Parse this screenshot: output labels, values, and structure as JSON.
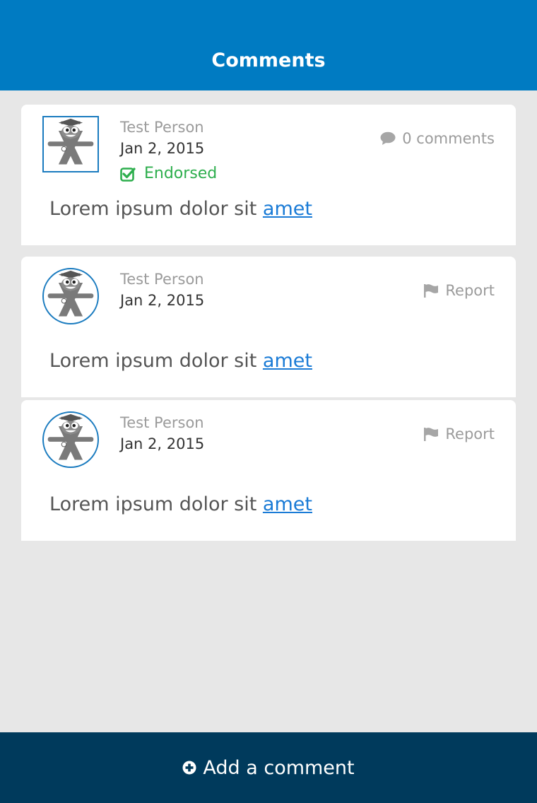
{
  "header": {
    "title": "Comments"
  },
  "comments": [
    {
      "author": "Test Person",
      "date": "Jan 2, 2015",
      "endorsed_label": "Endorsed",
      "meta_label": "0 comments",
      "meta_icon": "speech-bubble-icon",
      "body_text": "Lorem ipsum dolor sit ",
      "body_link": "amet",
      "avatar_shape": "square"
    },
    {
      "author": "Test Person",
      "date": "Jan 2, 2015",
      "meta_label": "Report",
      "meta_icon": "flag-icon",
      "body_text": "Lorem ipsum dolor sit ",
      "body_link": "amet",
      "avatar_shape": "round"
    },
    {
      "author": "Test Person",
      "date": "Jan 2, 2015",
      "meta_label": "Report",
      "meta_icon": "flag-icon",
      "body_text": "Lorem ipsum dolor sit ",
      "body_link": "amet",
      "avatar_shape": "round"
    }
  ],
  "footer": {
    "add_comment_label": "Add a comment"
  },
  "colors": {
    "header_bg": "#007bc2",
    "footer_bg": "#003a5c",
    "endorsed_green": "#2dae4d",
    "link_blue": "#1a7bd6",
    "page_bg": "#e7e7e7"
  }
}
